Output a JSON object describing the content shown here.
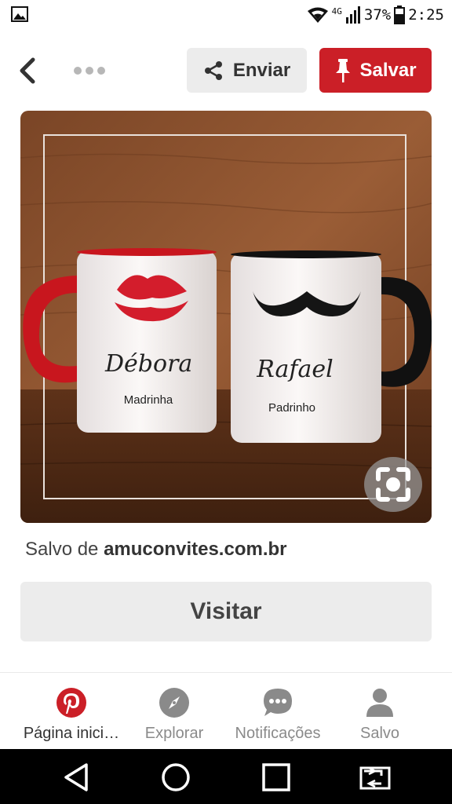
{
  "status": {
    "network": "4G",
    "battery": "37%",
    "time": "2:25"
  },
  "toolbar": {
    "send_label": "Enviar",
    "save_label": "Salvar"
  },
  "pin": {
    "mug_left_name": "Débora",
    "mug_left_role": "Madrinha",
    "mug_right_name": "Rafael",
    "mug_right_role": "Padrinho"
  },
  "source": {
    "prefix": "Salvo de",
    "domain": "amuconvites.com.br"
  },
  "visit_label": "Visitar",
  "tabs": [
    {
      "label": "Página inici…",
      "icon": "pinterest-logo-icon",
      "active": true
    },
    {
      "label": "Explorar",
      "icon": "compass-icon",
      "active": false
    },
    {
      "label": "Notificações",
      "icon": "chat-bubble-icon",
      "active": false
    },
    {
      "label": "Salvo",
      "icon": "person-icon",
      "active": false
    }
  ],
  "colors": {
    "brand_red": "#cb1f27",
    "button_gray": "#ececec",
    "text_dark": "#333333",
    "tab_inactive": "#8a8a8a"
  }
}
